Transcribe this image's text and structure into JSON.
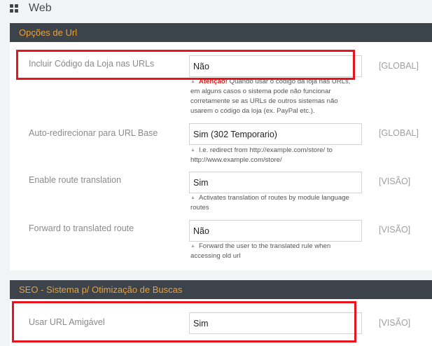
{
  "page": {
    "title": "Web"
  },
  "sections": {
    "url": {
      "title": "Opções de Url",
      "rows": [
        {
          "label": "Incluir Código da Loja nas URLs",
          "value": "Não",
          "scope": "[GLOBAL]",
          "note_warn": "Atenção!",
          "note": " Quando usar o código da loja nas URLs, em alguns casos o sistema pode não funcionar corretamente se as URLs de outros sistemas não usarem o código da loja (ex. PayPal etc.)."
        },
        {
          "label": "Auto-redirecionar para URL Base",
          "value": "Sim (302 Temporario)",
          "scope": "[GLOBAL]",
          "note": "I.e. redirect from http://example.com/store/ to http://www.example.com/store/"
        },
        {
          "label": "Enable route translation",
          "value": "Sim",
          "scope": "[VISÃO]",
          "note": "Activates translation of routes by module language routes"
        },
        {
          "label": "Forward to translated route",
          "value": "Não",
          "scope": "[VISÃO]",
          "note": "Forward the user to the translated rule when accessing old url"
        }
      ]
    },
    "seo": {
      "title": "SEO - Sistema p/ Otimização de Buscas",
      "rows": [
        {
          "label": "Usar URL Amigável",
          "value": "Sim",
          "scope": "[VISÃO]"
        }
      ]
    }
  },
  "colors": {
    "section_header_bg": "#3d434b",
    "section_header_text": "#e9a23b",
    "highlight": "#e8141d",
    "warning": "#e02020"
  }
}
